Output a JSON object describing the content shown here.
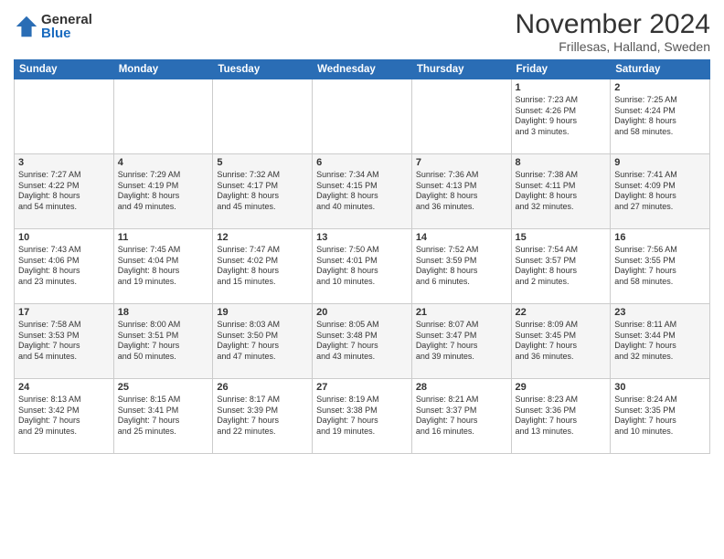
{
  "logo": {
    "general": "General",
    "blue": "Blue"
  },
  "title": "November 2024",
  "location": "Frillesas, Halland, Sweden",
  "days_header": [
    "Sunday",
    "Monday",
    "Tuesday",
    "Wednesday",
    "Thursday",
    "Friday",
    "Saturday"
  ],
  "weeks": [
    {
      "days": [
        {
          "num": "",
          "text": ""
        },
        {
          "num": "",
          "text": ""
        },
        {
          "num": "",
          "text": ""
        },
        {
          "num": "",
          "text": ""
        },
        {
          "num": "",
          "text": ""
        },
        {
          "num": "1",
          "text": "Sunrise: 7:23 AM\nSunset: 4:26 PM\nDaylight: 9 hours\nand 3 minutes."
        },
        {
          "num": "2",
          "text": "Sunrise: 7:25 AM\nSunset: 4:24 PM\nDaylight: 8 hours\nand 58 minutes."
        }
      ]
    },
    {
      "days": [
        {
          "num": "3",
          "text": "Sunrise: 7:27 AM\nSunset: 4:22 PM\nDaylight: 8 hours\nand 54 minutes."
        },
        {
          "num": "4",
          "text": "Sunrise: 7:29 AM\nSunset: 4:19 PM\nDaylight: 8 hours\nand 49 minutes."
        },
        {
          "num": "5",
          "text": "Sunrise: 7:32 AM\nSunset: 4:17 PM\nDaylight: 8 hours\nand 45 minutes."
        },
        {
          "num": "6",
          "text": "Sunrise: 7:34 AM\nSunset: 4:15 PM\nDaylight: 8 hours\nand 40 minutes."
        },
        {
          "num": "7",
          "text": "Sunrise: 7:36 AM\nSunset: 4:13 PM\nDaylight: 8 hours\nand 36 minutes."
        },
        {
          "num": "8",
          "text": "Sunrise: 7:38 AM\nSunset: 4:11 PM\nDaylight: 8 hours\nand 32 minutes."
        },
        {
          "num": "9",
          "text": "Sunrise: 7:41 AM\nSunset: 4:09 PM\nDaylight: 8 hours\nand 27 minutes."
        }
      ]
    },
    {
      "days": [
        {
          "num": "10",
          "text": "Sunrise: 7:43 AM\nSunset: 4:06 PM\nDaylight: 8 hours\nand 23 minutes."
        },
        {
          "num": "11",
          "text": "Sunrise: 7:45 AM\nSunset: 4:04 PM\nDaylight: 8 hours\nand 19 minutes."
        },
        {
          "num": "12",
          "text": "Sunrise: 7:47 AM\nSunset: 4:02 PM\nDaylight: 8 hours\nand 15 minutes."
        },
        {
          "num": "13",
          "text": "Sunrise: 7:50 AM\nSunset: 4:01 PM\nDaylight: 8 hours\nand 10 minutes."
        },
        {
          "num": "14",
          "text": "Sunrise: 7:52 AM\nSunset: 3:59 PM\nDaylight: 8 hours\nand 6 minutes."
        },
        {
          "num": "15",
          "text": "Sunrise: 7:54 AM\nSunset: 3:57 PM\nDaylight: 8 hours\nand 2 minutes."
        },
        {
          "num": "16",
          "text": "Sunrise: 7:56 AM\nSunset: 3:55 PM\nDaylight: 7 hours\nand 58 minutes."
        }
      ]
    },
    {
      "days": [
        {
          "num": "17",
          "text": "Sunrise: 7:58 AM\nSunset: 3:53 PM\nDaylight: 7 hours\nand 54 minutes."
        },
        {
          "num": "18",
          "text": "Sunrise: 8:00 AM\nSunset: 3:51 PM\nDaylight: 7 hours\nand 50 minutes."
        },
        {
          "num": "19",
          "text": "Sunrise: 8:03 AM\nSunset: 3:50 PM\nDaylight: 7 hours\nand 47 minutes."
        },
        {
          "num": "20",
          "text": "Sunrise: 8:05 AM\nSunset: 3:48 PM\nDaylight: 7 hours\nand 43 minutes."
        },
        {
          "num": "21",
          "text": "Sunrise: 8:07 AM\nSunset: 3:47 PM\nDaylight: 7 hours\nand 39 minutes."
        },
        {
          "num": "22",
          "text": "Sunrise: 8:09 AM\nSunset: 3:45 PM\nDaylight: 7 hours\nand 36 minutes."
        },
        {
          "num": "23",
          "text": "Sunrise: 8:11 AM\nSunset: 3:44 PM\nDaylight: 7 hours\nand 32 minutes."
        }
      ]
    },
    {
      "days": [
        {
          "num": "24",
          "text": "Sunrise: 8:13 AM\nSunset: 3:42 PM\nDaylight: 7 hours\nand 29 minutes."
        },
        {
          "num": "25",
          "text": "Sunrise: 8:15 AM\nSunset: 3:41 PM\nDaylight: 7 hours\nand 25 minutes."
        },
        {
          "num": "26",
          "text": "Sunrise: 8:17 AM\nSunset: 3:39 PM\nDaylight: 7 hours\nand 22 minutes."
        },
        {
          "num": "27",
          "text": "Sunrise: 8:19 AM\nSunset: 3:38 PM\nDaylight: 7 hours\nand 19 minutes."
        },
        {
          "num": "28",
          "text": "Sunrise: 8:21 AM\nSunset: 3:37 PM\nDaylight: 7 hours\nand 16 minutes."
        },
        {
          "num": "29",
          "text": "Sunrise: 8:23 AM\nSunset: 3:36 PM\nDaylight: 7 hours\nand 13 minutes."
        },
        {
          "num": "30",
          "text": "Sunrise: 8:24 AM\nSunset: 3:35 PM\nDaylight: 7 hours\nand 10 minutes."
        }
      ]
    }
  ]
}
